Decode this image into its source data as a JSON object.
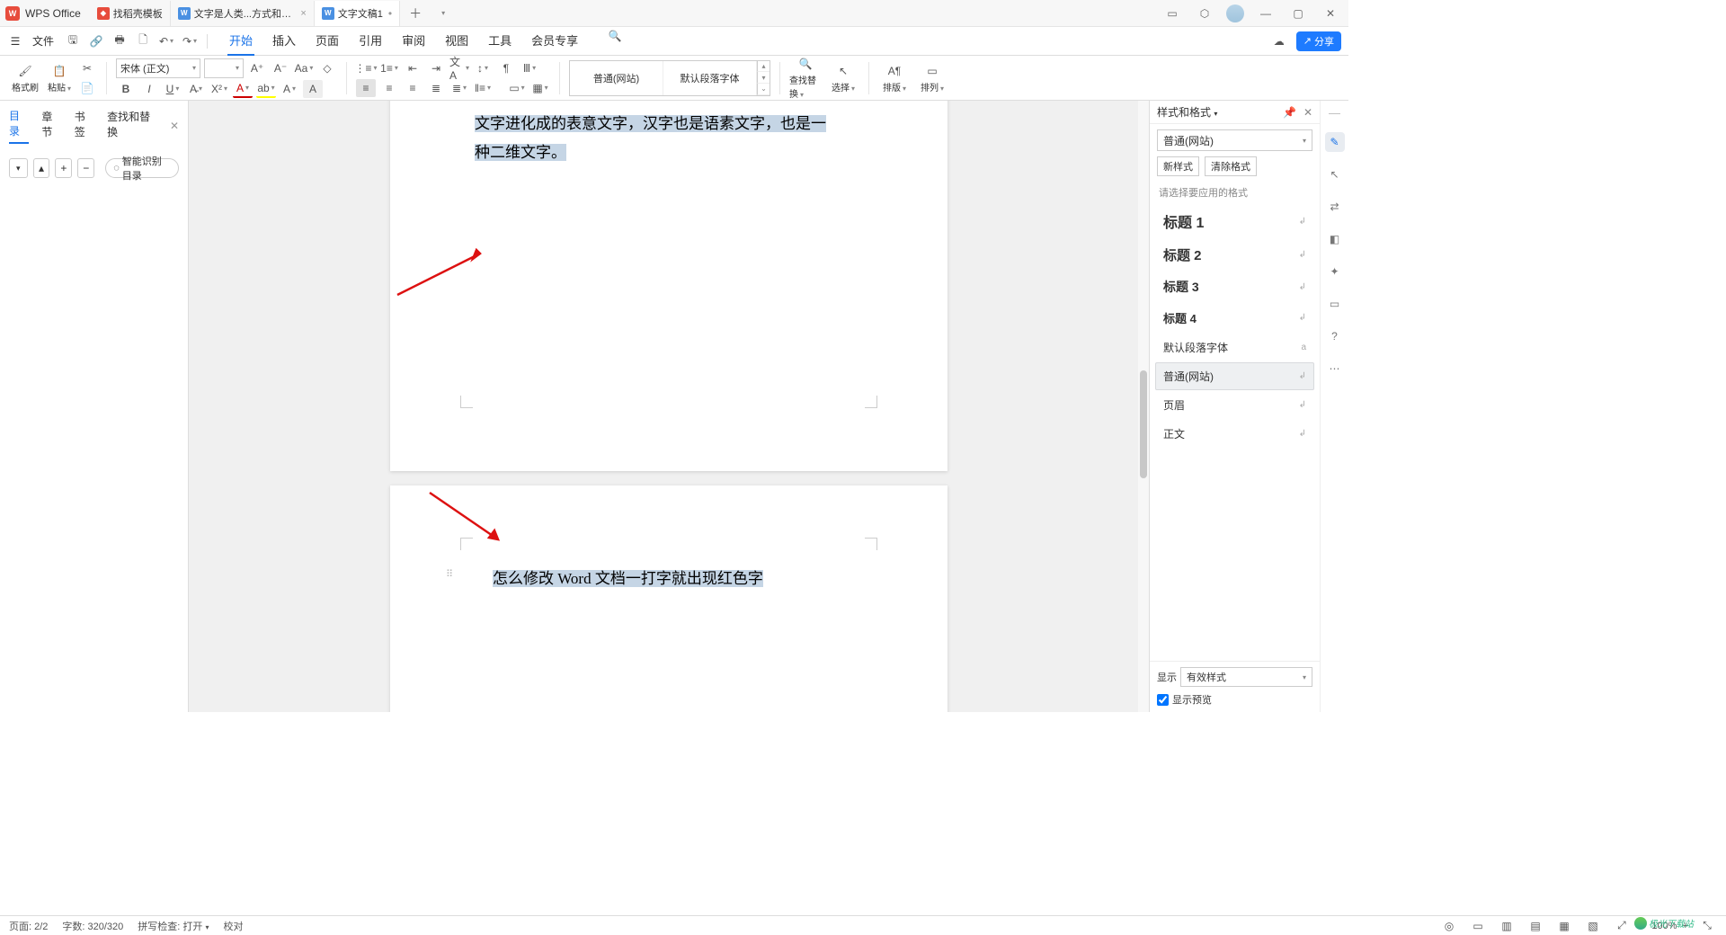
{
  "app": {
    "name": "WPS Office"
  },
  "tabs": [
    {
      "icon": "red",
      "label": "找稻壳模板"
    },
    {
      "icon": "blue",
      "label": "文字是人类...方式和工具"
    },
    {
      "icon": "blue",
      "label": "文字文稿1",
      "modified": true,
      "active": true
    }
  ],
  "menu": {
    "file": "文件",
    "items": [
      "开始",
      "插入",
      "页面",
      "引用",
      "审阅",
      "视图",
      "工具",
      "会员专享"
    ],
    "active": 0,
    "share": "分享"
  },
  "ribbon": {
    "brush": "格式刷",
    "paste": "粘贴",
    "font_name": "宋体 (正文)",
    "font_size": "",
    "style_current": "普通(网站)",
    "style_default": "默认段落字体",
    "find": "查找替换",
    "select": "选择",
    "layout": "排版",
    "arrange": "排列"
  },
  "left": {
    "tabs": [
      "目录",
      "章节",
      "书签",
      "查找和替换"
    ],
    "active": 0,
    "auto_toc": "智能识别目录"
  },
  "doc": {
    "p1_line1": "文字进化成的表意文字，汉字也是语素文字，也是一",
    "p1_line2": "种二维文字。",
    "p2_line1": "怎么修改 Word 文档一打字就出现红色字"
  },
  "styles_panel": {
    "title": "样式和格式",
    "current": "普通(网站)",
    "new_style": "新样式",
    "clear": "清除格式",
    "hint": "请选择要应用的格式",
    "list": [
      {
        "name": "标题 1",
        "cls": "h1"
      },
      {
        "name": "标题 2",
        "cls": "h2"
      },
      {
        "name": "标题 3",
        "cls": "h3"
      },
      {
        "name": "标题 4",
        "cls": "h4"
      },
      {
        "name": "默认段落字体",
        "cls": ""
      },
      {
        "name": "普通(网站)",
        "cls": "",
        "active": true
      },
      {
        "name": "页眉",
        "cls": ""
      },
      {
        "name": "正文",
        "cls": ""
      }
    ],
    "show_label": "显示",
    "show_value": "有效样式",
    "preview": "显示预览"
  },
  "status": {
    "page": "页面: 2/2",
    "words": "字数: 320/320",
    "spell": "拼写检查: 打开",
    "proof": "校对",
    "zoom": "100%"
  },
  "watermark": "极光下载站"
}
